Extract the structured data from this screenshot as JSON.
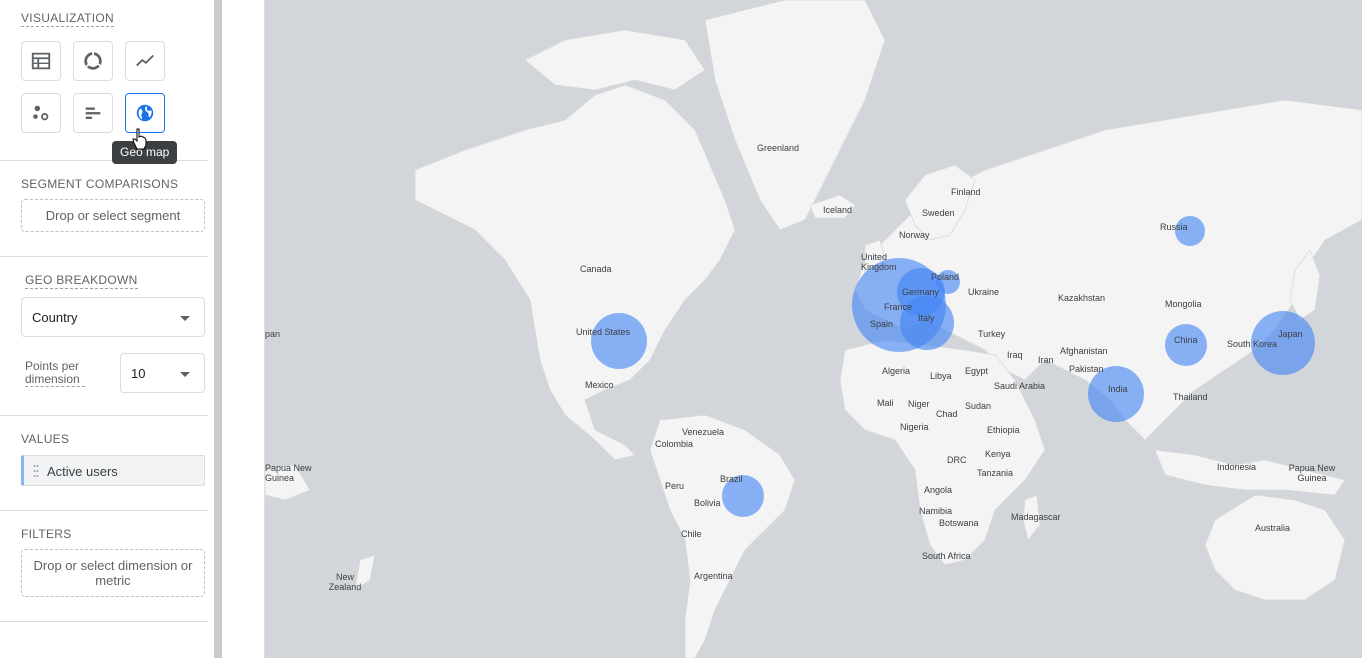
{
  "visualization": {
    "title": "VISUALIZATION",
    "buttons": [
      {
        "name": "table",
        "icon": "table-icon"
      },
      {
        "name": "donut",
        "icon": "donut-chart-icon"
      },
      {
        "name": "line",
        "icon": "line-chart-icon"
      },
      {
        "name": "scatter",
        "icon": "scatter-plot-icon"
      },
      {
        "name": "bar",
        "icon": "bar-chart-icon"
      },
      {
        "name": "geo",
        "icon": "globe-icon",
        "active": true
      }
    ],
    "tooltip": "Geo map"
  },
  "segments": {
    "title": "SEGMENT COMPARISONS",
    "drop_text": "Drop or select segment"
  },
  "geo": {
    "title": "GEO BREAKDOWN",
    "dimension_value": "Country",
    "points_label": "Points per dimension",
    "points_value": "10"
  },
  "values": {
    "title": "VALUES",
    "metric": "Active users"
  },
  "filters": {
    "title": "FILTERS",
    "drop_text": "Drop or select dimension or metric"
  },
  "colors": {
    "accent": "#1a73e8",
    "bubble": "#4285f4",
    "ocean": "#d2d6da",
    "land": "#f4f4f4"
  },
  "map_labels": [
    {
      "text": "Greenland"
    },
    {
      "text": "Iceland"
    },
    {
      "text": "Finland"
    },
    {
      "text": "Sweden"
    },
    {
      "text": "Norway"
    },
    {
      "text": "Russia"
    },
    {
      "text": "Canada"
    },
    {
      "text": "United Kingdom"
    },
    {
      "text": "Poland"
    },
    {
      "text": "Germany"
    },
    {
      "text": "Ukraine"
    },
    {
      "text": "Kazakhstan"
    },
    {
      "text": "France"
    },
    {
      "text": "Mongolia"
    },
    {
      "text": "Spain"
    },
    {
      "text": "Italy"
    },
    {
      "text": "Turkey"
    },
    {
      "text": "United States"
    },
    {
      "text": "Afghanistan"
    },
    {
      "text": "Iraq"
    },
    {
      "text": "Iran"
    },
    {
      "text": "China"
    },
    {
      "text": "Japan"
    },
    {
      "text": "South Korea"
    },
    {
      "text": "Algeria"
    },
    {
      "text": "Libya"
    },
    {
      "text": "Egypt"
    },
    {
      "text": "Pakistan"
    },
    {
      "text": "Saudi Arabia"
    },
    {
      "text": "Mexico"
    },
    {
      "text": "India"
    },
    {
      "text": "Thailand"
    },
    {
      "text": "Mali"
    },
    {
      "text": "Niger"
    },
    {
      "text": "Chad"
    },
    {
      "text": "Sudan"
    },
    {
      "text": "Venezuela"
    },
    {
      "text": "Nigeria"
    },
    {
      "text": "Ethiopia"
    },
    {
      "text": "Colombia"
    },
    {
      "text": "DRC"
    },
    {
      "text": "Kenya"
    },
    {
      "text": "Indonesia"
    },
    {
      "text": "Papua New Guinea"
    },
    {
      "text": "Tanzania"
    },
    {
      "text": "Brazil"
    },
    {
      "text": "Peru"
    },
    {
      "text": "Bolivia"
    },
    {
      "text": "Angola"
    },
    {
      "text": "Namibia"
    },
    {
      "text": "Botswana"
    },
    {
      "text": "Madagascar"
    },
    {
      "text": "Australia"
    },
    {
      "text": "Chile"
    },
    {
      "text": "South Africa"
    },
    {
      "text": "Argentina"
    },
    {
      "text": "New Zealand"
    },
    {
      "text": "Papua New Guinea"
    },
    {
      "text": "pan"
    }
  ]
}
